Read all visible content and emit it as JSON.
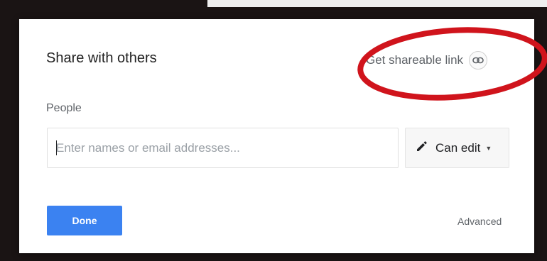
{
  "dialog": {
    "title": "Share with others",
    "get_link_label": "Get shareable link",
    "people_label": "People",
    "recipients_placeholder": "Enter names or email addresses...",
    "permission": {
      "selected": "Can edit"
    },
    "done_label": "Done",
    "advanced_label": "Advanced"
  },
  "icons": {
    "link": "link-icon",
    "permission": "pencil-icon",
    "dropdown": "chevron-down-icon"
  },
  "colors": {
    "primary_button": "#3b82f1",
    "annotation_ring": "#d0141c",
    "backdrop": "#1a1414"
  }
}
